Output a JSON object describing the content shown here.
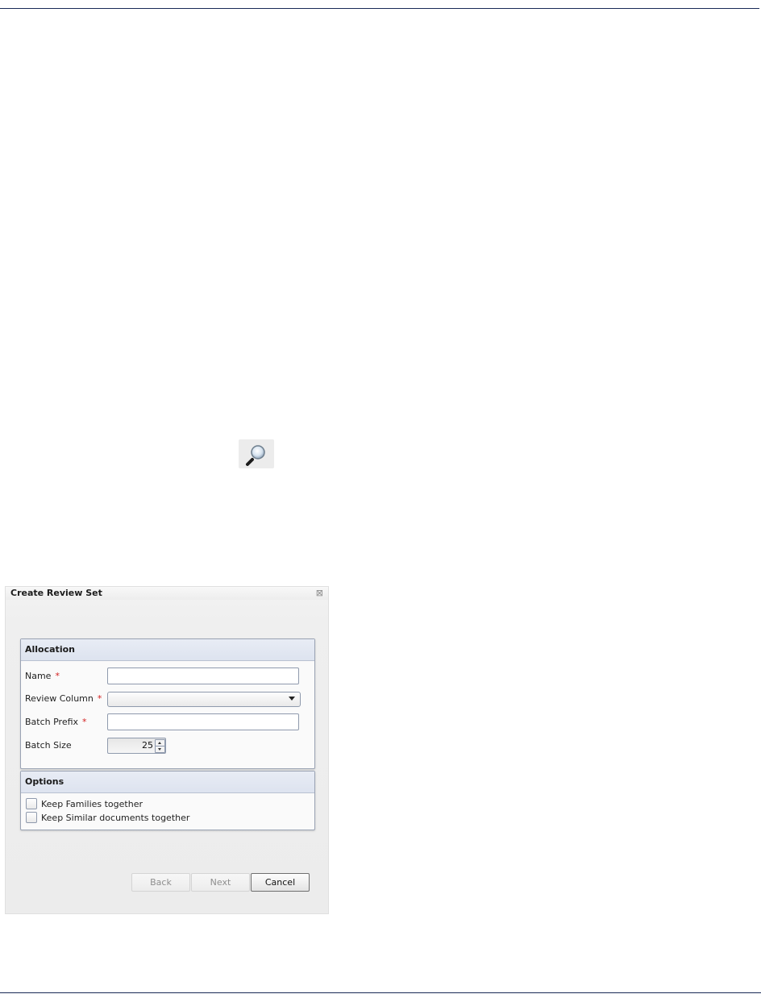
{
  "dialog": {
    "title": "Create Review Set",
    "close_glyph": "⊠"
  },
  "allocation": {
    "heading": "Allocation",
    "required_marker": "*",
    "name_label": "Name",
    "name_value": "",
    "review_column_label": "Review Column",
    "review_column_value": "",
    "batch_prefix_label": "Batch Prefix",
    "batch_prefix_value": "",
    "batch_size_label": "Batch Size",
    "batch_size_value": "25"
  },
  "options": {
    "heading": "Options",
    "keep_families_label": "Keep Families together",
    "keep_families_checked": false,
    "keep_similar_label": "Keep Similar documents together",
    "keep_similar_checked": false
  },
  "buttons": {
    "back_label": "Back",
    "next_label": "Next",
    "cancel_label": "Cancel"
  },
  "icons": {
    "search": "magnifier-icon"
  },
  "colors": {
    "rule": "#1a2a57",
    "required": "#d32020",
    "group_header": "#dde3ef"
  }
}
